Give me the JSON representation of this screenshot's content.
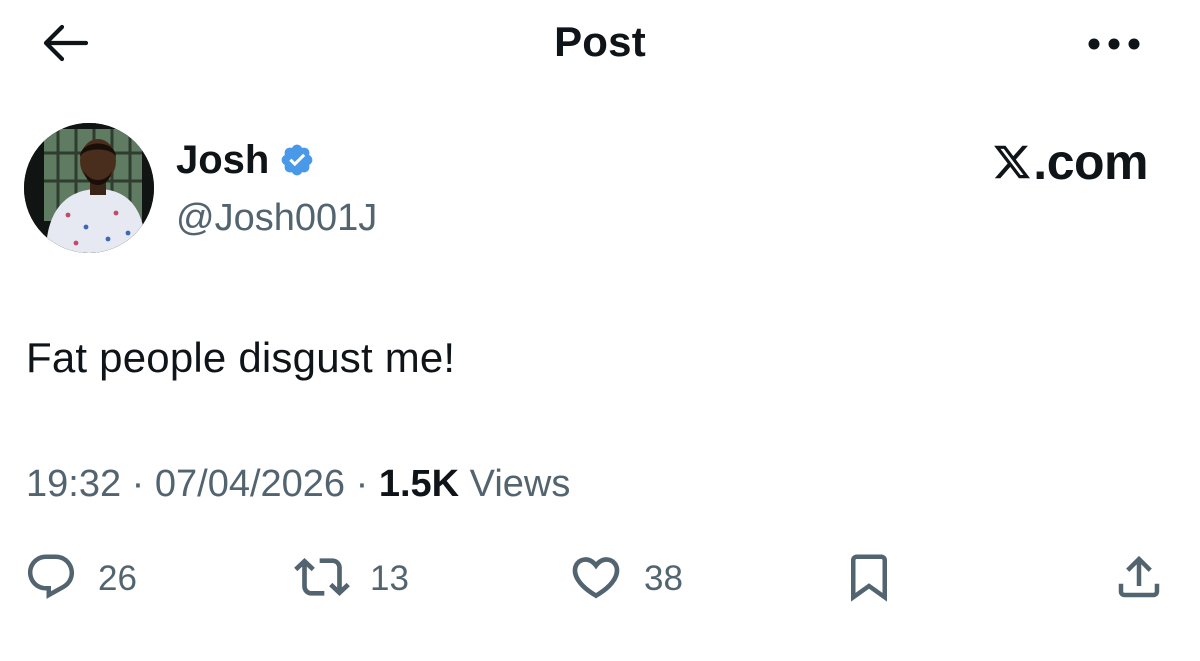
{
  "header": {
    "title": "Post",
    "back_icon": "arrow-left-icon",
    "more_icon": "more-horizontal-icon"
  },
  "author": {
    "name": "Josh",
    "handle": "@Josh001J",
    "verified": true,
    "verified_color": "#4a99e9"
  },
  "brand": {
    "label": ".com",
    "icon": "x-logo-icon"
  },
  "post": {
    "text": "Fat people disgust me!"
  },
  "meta": {
    "time": "19:32",
    "separator": " · ",
    "date": "07/04/2026",
    "views_count": "1.5K",
    "views_label": " Views"
  },
  "actions": {
    "reply_count": "26",
    "repost_count": "13",
    "like_count": "38",
    "bookmark_icon": "bookmark-icon",
    "share_icon": "share-icon"
  },
  "colors": {
    "text_primary": "#0f1419",
    "text_secondary": "#536471",
    "background": "#ffffff"
  }
}
